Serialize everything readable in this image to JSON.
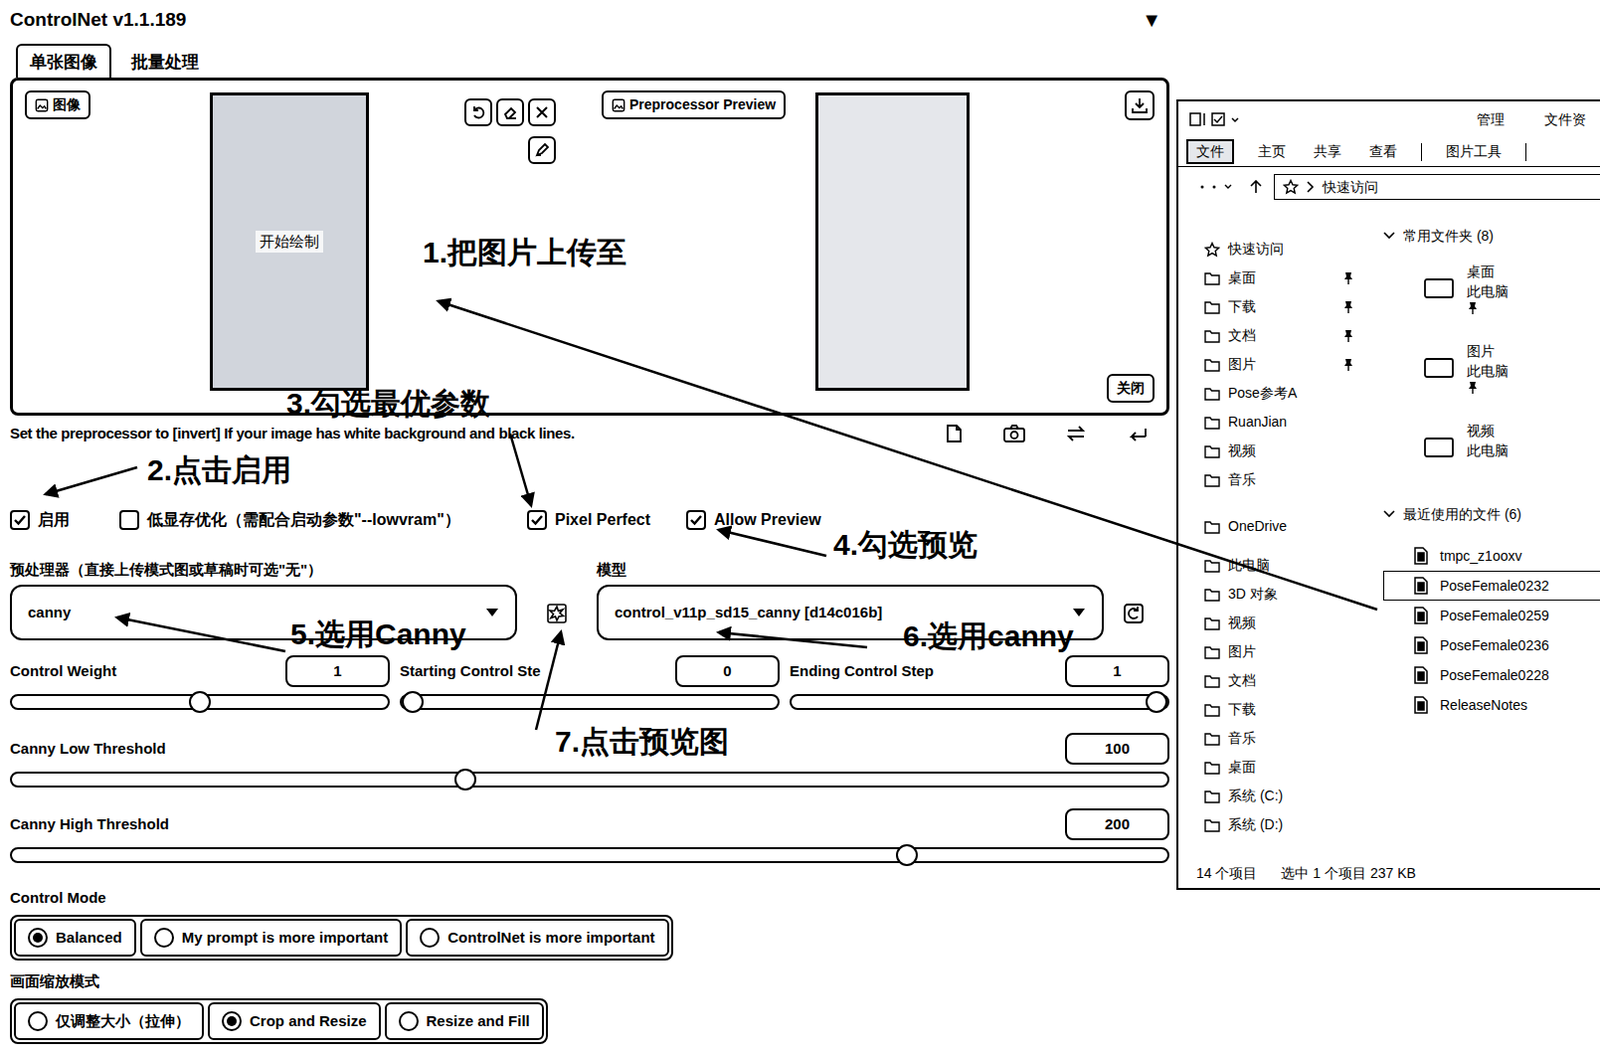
{
  "title": "ControlNet v1.1.189",
  "collapse": "▼",
  "tabs": [
    {
      "label": "单张图像",
      "selected": true
    },
    {
      "label": "批量处理",
      "selected": false
    }
  ],
  "image_panel": {
    "input_label": "图像",
    "canvas_text": "开始绘制",
    "preview_label": "Preprocessor Preview",
    "close_button": "关闭"
  },
  "hint": "Set the preprocessor to [invert] If your image has white background and black lines.",
  "options": [
    {
      "label": "启用",
      "checked": true
    },
    {
      "label": "低显存优化（需配合启动参数\"--lowvram\"）",
      "checked": false
    },
    {
      "label": "Pixel Perfect",
      "checked": true
    },
    {
      "label": "Allow Preview",
      "checked": true
    }
  ],
  "preprocessor": {
    "label": "预处理器（直接上传模式图或草稿时可选\"无\"）",
    "value": "canny"
  },
  "model": {
    "label": "模型",
    "value": "control_v11p_sd15_canny [d14c016b]"
  },
  "steps": [
    {
      "label": "Control Weight",
      "value": "1",
      "level": 0.5
    },
    {
      "label": "Starting Control Ste",
      "value": "0",
      "level": 0
    },
    {
      "label": "Ending Control Step",
      "value": "1",
      "level": 1
    }
  ],
  "thresholds": [
    {
      "label": "Canny Low Threshold",
      "value": "100",
      "level": 0.39
    },
    {
      "label": "Canny High Threshold",
      "value": "200",
      "level": 0.78
    }
  ],
  "control_mode": {
    "label": "Control Mode",
    "options": [
      {
        "label": "Balanced",
        "selected": true
      },
      {
        "label": "My prompt is more important",
        "selected": false
      },
      {
        "label": "ControlNet is more important",
        "selected": false
      }
    ]
  },
  "resize_mode": {
    "label": "画面缩放模式",
    "options": [
      {
        "label": "仅调整大小（拉伸）",
        "selected": false
      },
      {
        "label": "Crop and Resize",
        "selected": true
      },
      {
        "label": "Resize and Fill",
        "selected": false
      }
    ]
  },
  "annotations": [
    "1.把图片上传至",
    "2.点击启用",
    "3.勾选最优参数",
    "4.勾选预览",
    "5.选用Canny",
    "6.选用canny",
    "7.点击预览图"
  ],
  "explorer": {
    "title_tabs": [
      "管理",
      "文件资"
    ],
    "ribbon": [
      {
        "label": "文件",
        "selected": true
      },
      {
        "label": "主页",
        "selected": false
      },
      {
        "label": "共享",
        "selected": false
      },
      {
        "label": "查看",
        "selected": false
      },
      {
        "label": "图片工具",
        "selected": false
      }
    ],
    "address": "快速访问",
    "nav_groups": [
      [
        {
          "label": "快速访问",
          "pinned": false
        },
        {
          "label": "桌面",
          "pinned": true
        },
        {
          "label": "下载",
          "pinned": true
        },
        {
          "label": "文档",
          "pinned": true
        },
        {
          "label": "图片",
          "pinned": true
        },
        {
          "label": "Pose参考A",
          "pinned": false
        },
        {
          "label": "RuanJian",
          "pinned": false
        },
        {
          "label": "视频",
          "pinned": false
        },
        {
          "label": "音乐",
          "pinned": false
        }
      ],
      [
        {
          "label": "OneDrive",
          "pinned": false
        }
      ],
      [
        {
          "label": "此电脑",
          "pinned": false
        },
        {
          "label": "3D 对象",
          "pinned": false
        },
        {
          "label": "视频",
          "pinned": false
        },
        {
          "label": "图片",
          "pinned": false
        },
        {
          "label": "文档",
          "pinned": false
        },
        {
          "label": "下载",
          "pinned": false
        },
        {
          "label": "音乐",
          "pinned": false
        },
        {
          "label": "桌面",
          "pinned": false
        },
        {
          "label": "系统 (C:)",
          "pinned": false
        },
        {
          "label": "系统 (D:)",
          "pinned": false
        }
      ]
    ],
    "frequent": {
      "header": "常用文件夹 (8)",
      "items": [
        {
          "name": "桌面",
          "location": "此电脑",
          "pinned": true
        },
        {
          "name": "图片",
          "location": "此电脑",
          "pinned": true
        },
        {
          "name": "视频",
          "location": "此电脑",
          "pinned": false
        }
      ]
    },
    "recent": {
      "header": "最近使用的文件 (6)",
      "items": [
        {
          "name": "tmpc_z1ooxv",
          "selected": false
        },
        {
          "name": "PoseFemale0232",
          "selected": true
        },
        {
          "name": "PoseFemale0259",
          "selected": false
        },
        {
          "name": "PoseFemale0236",
          "selected": false
        },
        {
          "name": "PoseFemale0228",
          "selected": false
        },
        {
          "name": "ReleaseNotes",
          "selected": false
        }
      ]
    },
    "status": {
      "count": "14 个项目",
      "selection": "选中 1 个项目 237 KB"
    }
  }
}
